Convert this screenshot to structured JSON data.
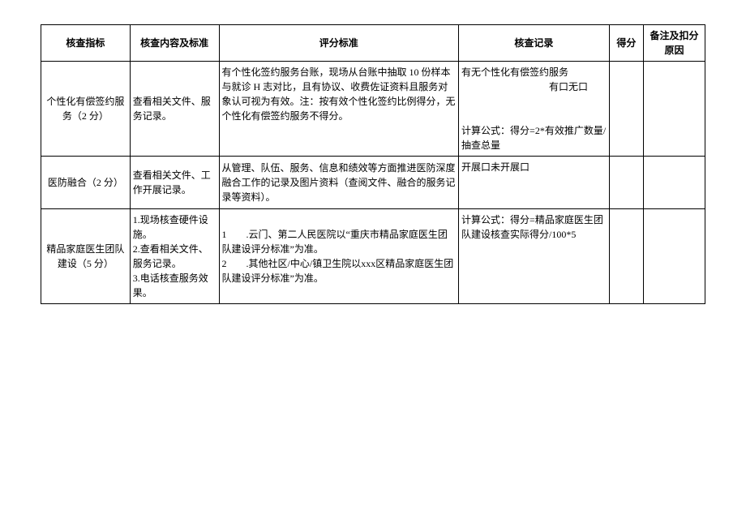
{
  "headers": {
    "indicator": "核查指标",
    "content": "核查内容及标准",
    "criteria": "评分标准",
    "record": "核查记录",
    "score": "得分",
    "remark": "备注及扣分原因"
  },
  "rows": [
    {
      "indicator": "个性化有偿签约服务（2 分）",
      "content": "查看相关文件、服务记录。",
      "criteria": "有个性化签约服务台账，现场从台账中抽取 10 份样本与就诊 H 志对比，且有协议、收费佐证资料且服务对象认可视为有效。注：按有效个性化签约比例得分，无个性化有偿签约服务不得分。",
      "record": "有无个性化有偿签约服务\n　　　　　　　　　有口无口\n\n计算公式：得分=2*有效推广数量/抽查总量",
      "score": "",
      "remark": ""
    },
    {
      "indicator": "医防融合（2 分）",
      "content": "查看相关文件、工作开展记录。",
      "criteria": "从管理、队伍、服务、信息和绩效等方面推进医防深度融合工作的记录及图片资料（查阅文件、融合的服务记录等资料）。",
      "record": "开展口未开展口",
      "score": "",
      "remark": ""
    },
    {
      "indicator": "精品家庭医生团队建设（5 分）",
      "content": "1.现场核查硬件设施。\n2.查看相关文件、服务记录。\n3.电话核查服务效果。",
      "criteria": "1　　.云门、第二人民医院以“重庆市精品家庭医生团队建设评分标准”为准。\n2　　.其他社区/中心/镇卫生院以xxx区精品家庭医生团队建设评分标准”为准。",
      "record": "计算公式：得分=精品家庭医生团队建设核查实际得分/100*5",
      "score": "",
      "remark": ""
    }
  ]
}
